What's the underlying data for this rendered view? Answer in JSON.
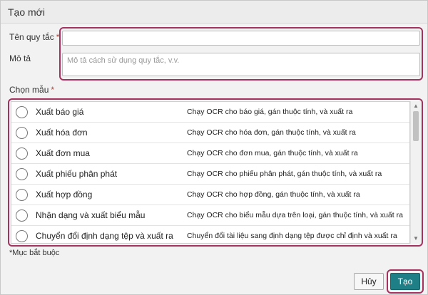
{
  "dialog": {
    "title": "Tạo mới"
  },
  "form": {
    "rule_name": {
      "label": "Tên quy tắc",
      "required_mark": "*",
      "value": ""
    },
    "description": {
      "label": "Mô tả",
      "placeholder": "Mô tả cách sử dụng quy tắc, v.v.",
      "value": ""
    },
    "template": {
      "label": "Chọn mẫu",
      "required_mark": "*"
    },
    "required_note": "*Mục bắt buộc"
  },
  "templates": [
    {
      "name": "Xuất báo giá",
      "description": "Chạy OCR cho báo giá, gán thuộc tính, và xuất ra"
    },
    {
      "name": "Xuất hóa đơn",
      "description": "Chạy OCR cho hóa đơn, gán thuộc tính, và xuất ra"
    },
    {
      "name": "Xuất đơn mua",
      "description": "Chạy OCR cho đơn mua, gán thuộc tính, và xuất ra"
    },
    {
      "name": "Xuất phiếu phân phát",
      "description": "Chạy OCR cho phiếu phân phát, gán thuộc tính, và xuất ra"
    },
    {
      "name": "Xuất hợp đồng",
      "description": "Chạy OCR cho hợp đồng, gán thuộc tính, và xuất ra"
    },
    {
      "name": "Nhận dạng và xuất biểu mẫu",
      "description": "Chạy OCR cho biểu mẫu dựa trên loại, gán thuộc tính, và xuất ra"
    },
    {
      "name": "Chuyển đổi định dạng tệp và xuất ra",
      "description": "Chuyển đổi tài liệu sang định dạng tệp được chỉ định và xuất ra"
    }
  ],
  "buttons": {
    "cancel": "Hủy",
    "create": "Tạo"
  },
  "colors": {
    "highlight": "#a3325f",
    "primary_button": "#1e7f86"
  }
}
